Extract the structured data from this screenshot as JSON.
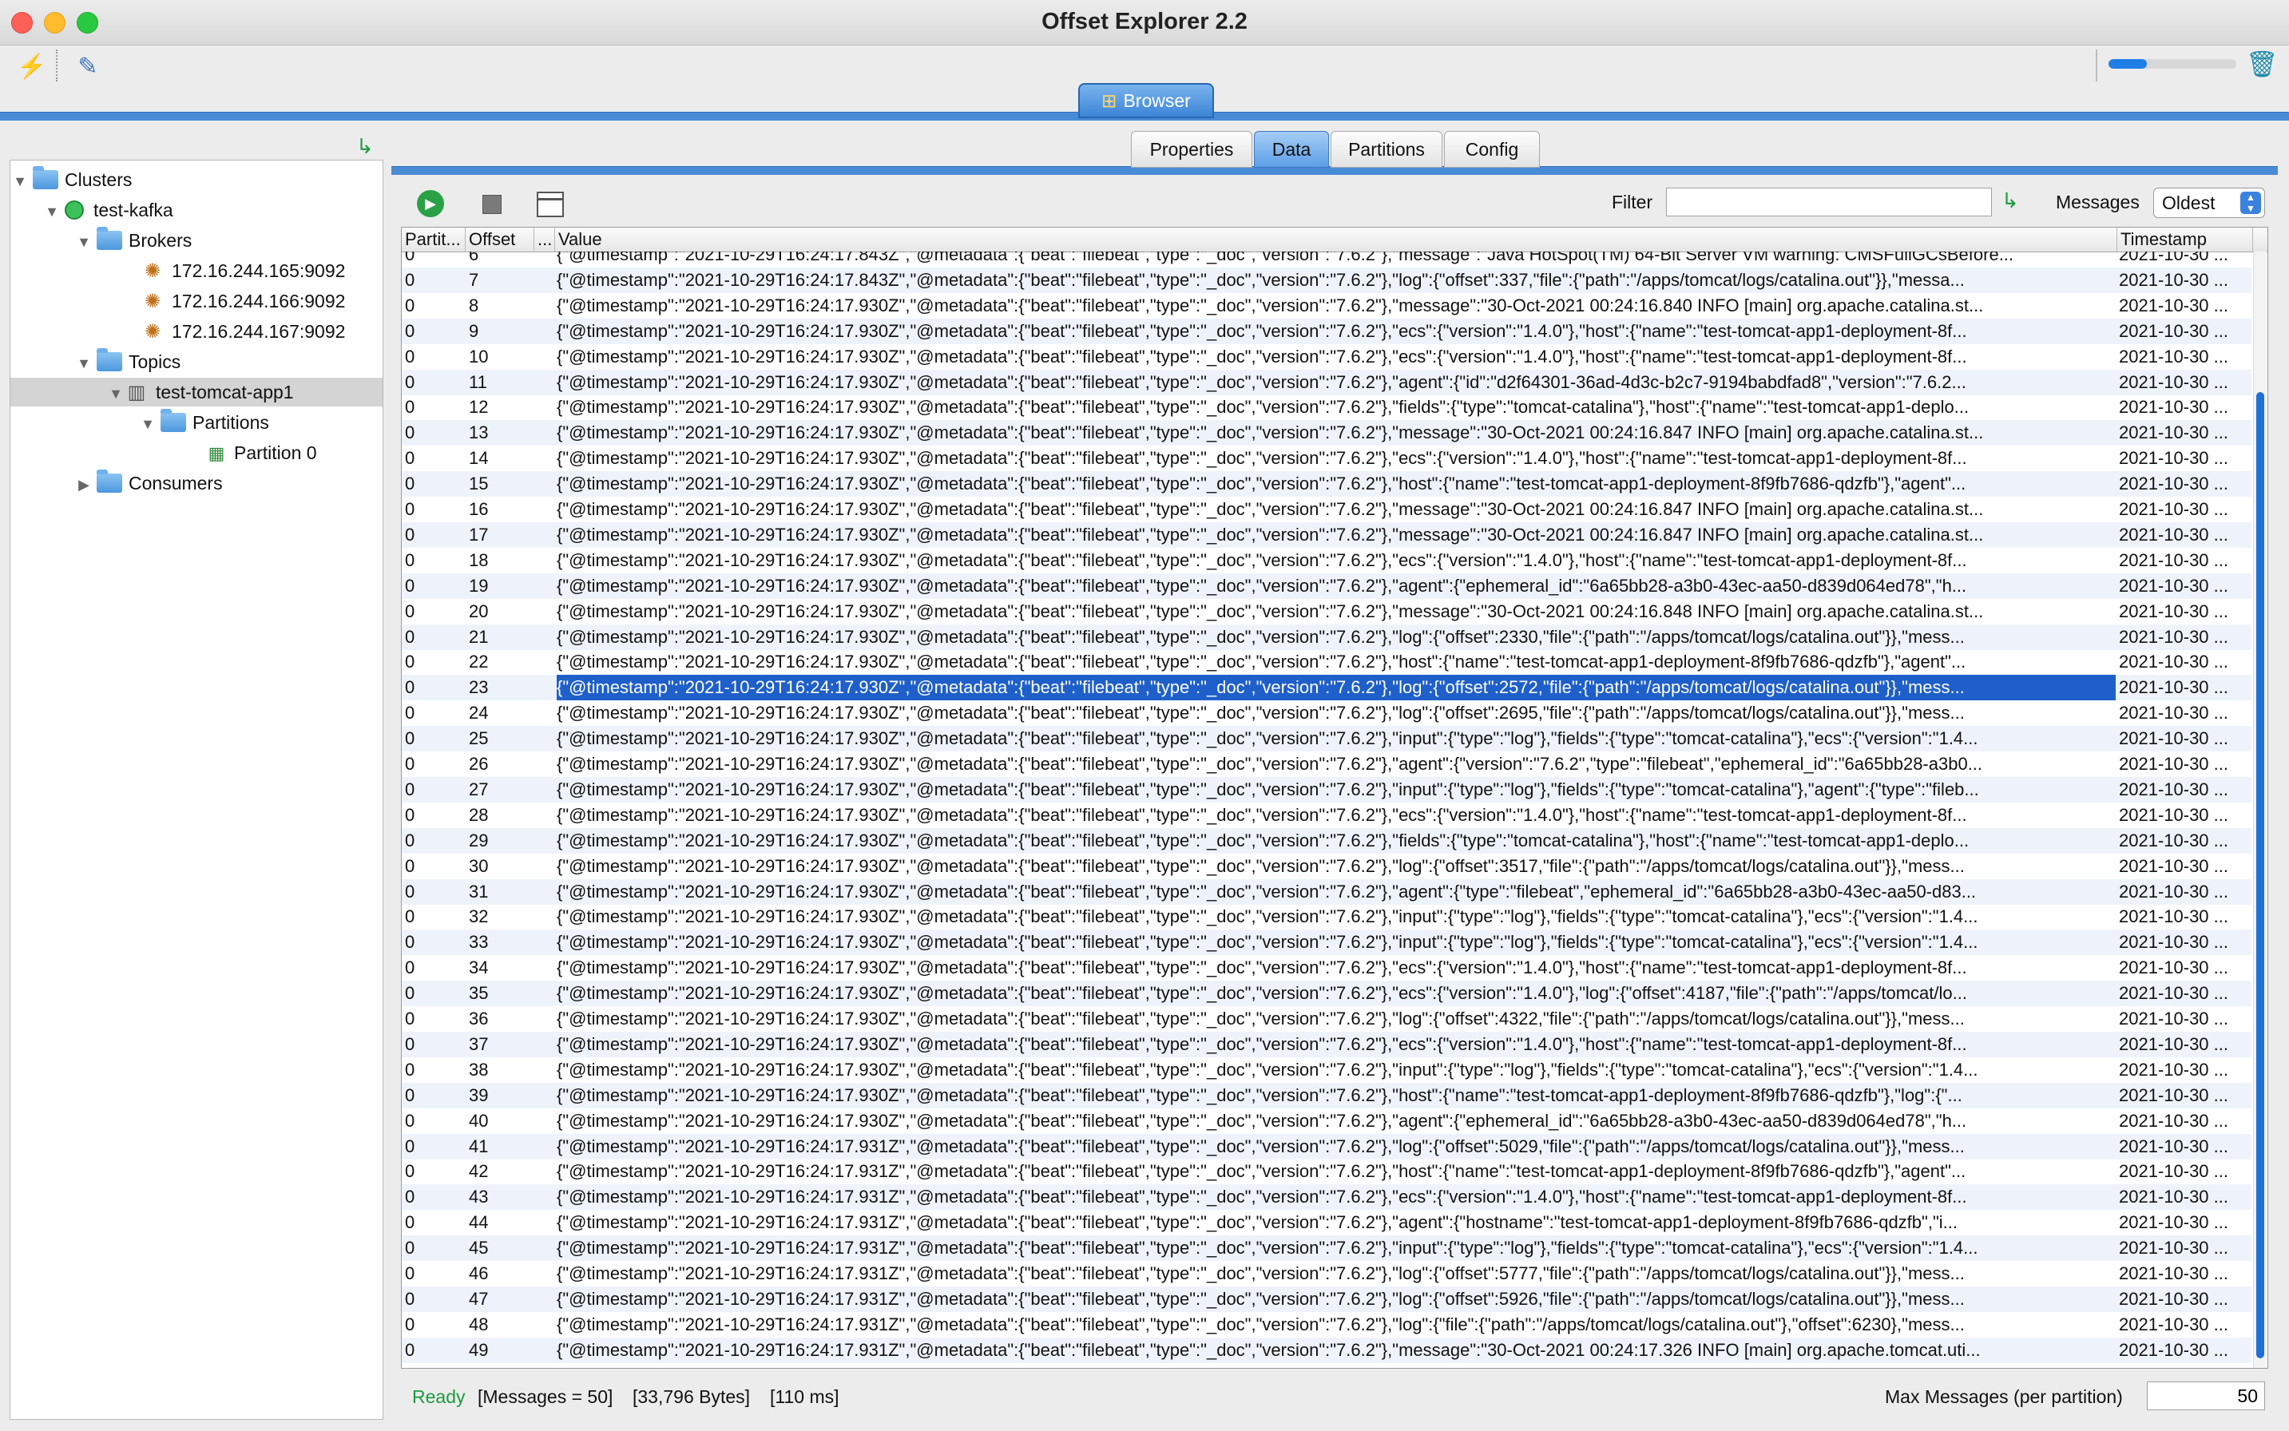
{
  "window": {
    "title": "Offset Explorer  2.2"
  },
  "toolbar": {
    "progress": 0.3
  },
  "main_tab": {
    "label": "Browser"
  },
  "tree": {
    "clusters_label": "Clusters",
    "cluster_name": "test-kafka",
    "brokers_label": "Brokers",
    "brokers": [
      "172.16.244.165:9092",
      "172.16.244.166:9092",
      "172.16.244.167:9092"
    ],
    "topics_label": "Topics",
    "topic_name": "test-tomcat-app1",
    "partitions_label": "Partitions",
    "partition_label": "Partition 0",
    "consumers_label": "Consumers"
  },
  "subtabs": [
    "Properties",
    "Data",
    "Partitions",
    "Config"
  ],
  "data_toolbar": {
    "filter_label": "Filter",
    "filter_value": "",
    "messages_label": "Messages",
    "messages_selected": "Oldest"
  },
  "table": {
    "columns": [
      "Partit...",
      "Offset",
      "...",
      "Value",
      "Timestamp"
    ],
    "rows": [
      [
        "0",
        "6",
        "",
        "{\"@timestamp\":\"2021-10-29T16:24:17.843Z\",\"@metadata\":{\"beat\":\"filebeat\",\"type\":\"_doc\",\"version\":\"7.6.2\"},\"message\":\"Java HotSpot(TM) 64-Bit Server VM warning: CMSFullGCsBefore...",
        "2021-10-30 ..."
      ],
      [
        "0",
        "7",
        "",
        "{\"@timestamp\":\"2021-10-29T16:24:17.843Z\",\"@metadata\":{\"beat\":\"filebeat\",\"type\":\"_doc\",\"version\":\"7.6.2\"},\"log\":{\"offset\":337,\"file\":{\"path\":\"/apps/tomcat/logs/catalina.out\"}},\"messa...",
        "2021-10-30 ..."
      ],
      [
        "0",
        "8",
        "",
        "{\"@timestamp\":\"2021-10-29T16:24:17.930Z\",\"@metadata\":{\"beat\":\"filebeat\",\"type\":\"_doc\",\"version\":\"7.6.2\"},\"message\":\"30-Oct-2021 00:24:16.840 INFO [main] org.apache.catalina.st...",
        "2021-10-30 ..."
      ],
      [
        "0",
        "9",
        "",
        "{\"@timestamp\":\"2021-10-29T16:24:17.930Z\",\"@metadata\":{\"beat\":\"filebeat\",\"type\":\"_doc\",\"version\":\"7.6.2\"},\"ecs\":{\"version\":\"1.4.0\"},\"host\":{\"name\":\"test-tomcat-app1-deployment-8f...",
        "2021-10-30 ..."
      ],
      [
        "0",
        "10",
        "",
        "{\"@timestamp\":\"2021-10-29T16:24:17.930Z\",\"@metadata\":{\"beat\":\"filebeat\",\"type\":\"_doc\",\"version\":\"7.6.2\"},\"ecs\":{\"version\":\"1.4.0\"},\"host\":{\"name\":\"test-tomcat-app1-deployment-8f...",
        "2021-10-30 ..."
      ],
      [
        "0",
        "11",
        "",
        "{\"@timestamp\":\"2021-10-29T16:24:17.930Z\",\"@metadata\":{\"beat\":\"filebeat\",\"type\":\"_doc\",\"version\":\"7.6.2\"},\"agent\":{\"id\":\"d2f64301-36ad-4d3c-b2c7-9194babdfad8\",\"version\":\"7.6.2...",
        "2021-10-30 ..."
      ],
      [
        "0",
        "12",
        "",
        "{\"@timestamp\":\"2021-10-29T16:24:17.930Z\",\"@metadata\":{\"beat\":\"filebeat\",\"type\":\"_doc\",\"version\":\"7.6.2\"},\"fields\":{\"type\":\"tomcat-catalina\"},\"host\":{\"name\":\"test-tomcat-app1-deplo...",
        "2021-10-30 ..."
      ],
      [
        "0",
        "13",
        "",
        "{\"@timestamp\":\"2021-10-29T16:24:17.930Z\",\"@metadata\":{\"beat\":\"filebeat\",\"type\":\"_doc\",\"version\":\"7.6.2\"},\"message\":\"30-Oct-2021 00:24:16.847 INFO [main] org.apache.catalina.st...",
        "2021-10-30 ..."
      ],
      [
        "0",
        "14",
        "",
        "{\"@timestamp\":\"2021-10-29T16:24:17.930Z\",\"@metadata\":{\"beat\":\"filebeat\",\"type\":\"_doc\",\"version\":\"7.6.2\"},\"ecs\":{\"version\":\"1.4.0\"},\"host\":{\"name\":\"test-tomcat-app1-deployment-8f...",
        "2021-10-30 ..."
      ],
      [
        "0",
        "15",
        "",
        "{\"@timestamp\":\"2021-10-29T16:24:17.930Z\",\"@metadata\":{\"beat\":\"filebeat\",\"type\":\"_doc\",\"version\":\"7.6.2\"},\"host\":{\"name\":\"test-tomcat-app1-deployment-8f9fb7686-qdzfb\"},\"agent\"...",
        "2021-10-30 ..."
      ],
      [
        "0",
        "16",
        "",
        "{\"@timestamp\":\"2021-10-29T16:24:17.930Z\",\"@metadata\":{\"beat\":\"filebeat\",\"type\":\"_doc\",\"version\":\"7.6.2\"},\"message\":\"30-Oct-2021 00:24:16.847 INFO [main] org.apache.catalina.st...",
        "2021-10-30 ..."
      ],
      [
        "0",
        "17",
        "",
        "{\"@timestamp\":\"2021-10-29T16:24:17.930Z\",\"@metadata\":{\"beat\":\"filebeat\",\"type\":\"_doc\",\"version\":\"7.6.2\"},\"message\":\"30-Oct-2021 00:24:16.847 INFO [main] org.apache.catalina.st...",
        "2021-10-30 ..."
      ],
      [
        "0",
        "18",
        "",
        "{\"@timestamp\":\"2021-10-29T16:24:17.930Z\",\"@metadata\":{\"beat\":\"filebeat\",\"type\":\"_doc\",\"version\":\"7.6.2\"},\"ecs\":{\"version\":\"1.4.0\"},\"host\":{\"name\":\"test-tomcat-app1-deployment-8f...",
        "2021-10-30 ..."
      ],
      [
        "0",
        "19",
        "",
        "{\"@timestamp\":\"2021-10-29T16:24:17.930Z\",\"@metadata\":{\"beat\":\"filebeat\",\"type\":\"_doc\",\"version\":\"7.6.2\"},\"agent\":{\"ephemeral_id\":\"6a65bb28-a3b0-43ec-aa50-d839d064ed78\",\"h...",
        "2021-10-30 ..."
      ],
      [
        "0",
        "20",
        "",
        "{\"@timestamp\":\"2021-10-29T16:24:17.930Z\",\"@metadata\":{\"beat\":\"filebeat\",\"type\":\"_doc\",\"version\":\"7.6.2\"},\"message\":\"30-Oct-2021 00:24:16.848 INFO [main] org.apache.catalina.st...",
        "2021-10-30 ..."
      ],
      [
        "0",
        "21",
        "",
        "{\"@timestamp\":\"2021-10-29T16:24:17.930Z\",\"@metadata\":{\"beat\":\"filebeat\",\"type\":\"_doc\",\"version\":\"7.6.2\"},\"log\":{\"offset\":2330,\"file\":{\"path\":\"/apps/tomcat/logs/catalina.out\"}},\"mess...",
        "2021-10-30 ..."
      ],
      [
        "0",
        "22",
        "",
        "{\"@timestamp\":\"2021-10-29T16:24:17.930Z\",\"@metadata\":{\"beat\":\"filebeat\",\"type\":\"_doc\",\"version\":\"7.6.2\"},\"host\":{\"name\":\"test-tomcat-app1-deployment-8f9fb7686-qdzfb\"},\"agent\"...",
        "2021-10-30 ..."
      ],
      [
        "0",
        "23",
        "",
        "{\"@timestamp\":\"2021-10-29T16:24:17.930Z\",\"@metadata\":{\"beat\":\"filebeat\",\"type\":\"_doc\",\"version\":\"7.6.2\"},\"log\":{\"offset\":2572,\"file\":{\"path\":\"/apps/tomcat/logs/catalina.out\"}},\"mess...",
        "2021-10-30 ..."
      ],
      [
        "0",
        "24",
        "",
        "{\"@timestamp\":\"2021-10-29T16:24:17.930Z\",\"@metadata\":{\"beat\":\"filebeat\",\"type\":\"_doc\",\"version\":\"7.6.2\"},\"log\":{\"offset\":2695,\"file\":{\"path\":\"/apps/tomcat/logs/catalina.out\"}},\"mess...",
        "2021-10-30 ..."
      ],
      [
        "0",
        "25",
        "",
        "{\"@timestamp\":\"2021-10-29T16:24:17.930Z\",\"@metadata\":{\"beat\":\"filebeat\",\"type\":\"_doc\",\"version\":\"7.6.2\"},\"input\":{\"type\":\"log\"},\"fields\":{\"type\":\"tomcat-catalina\"},\"ecs\":{\"version\":\"1.4...",
        "2021-10-30 ..."
      ],
      [
        "0",
        "26",
        "",
        "{\"@timestamp\":\"2021-10-29T16:24:17.930Z\",\"@metadata\":{\"beat\":\"filebeat\",\"type\":\"_doc\",\"version\":\"7.6.2\"},\"agent\":{\"version\":\"7.6.2\",\"type\":\"filebeat\",\"ephemeral_id\":\"6a65bb28-a3b0...",
        "2021-10-30 ..."
      ],
      [
        "0",
        "27",
        "",
        "{\"@timestamp\":\"2021-10-29T16:24:17.930Z\",\"@metadata\":{\"beat\":\"filebeat\",\"type\":\"_doc\",\"version\":\"7.6.2\"},\"input\":{\"type\":\"log\"},\"fields\":{\"type\":\"tomcat-catalina\"},\"agent\":{\"type\":\"fileb...",
        "2021-10-30 ..."
      ],
      [
        "0",
        "28",
        "",
        "{\"@timestamp\":\"2021-10-29T16:24:17.930Z\",\"@metadata\":{\"beat\":\"filebeat\",\"type\":\"_doc\",\"version\":\"7.6.2\"},\"ecs\":{\"version\":\"1.4.0\"},\"host\":{\"name\":\"test-tomcat-app1-deployment-8f...",
        "2021-10-30 ..."
      ],
      [
        "0",
        "29",
        "",
        "{\"@timestamp\":\"2021-10-29T16:24:17.930Z\",\"@metadata\":{\"beat\":\"filebeat\",\"type\":\"_doc\",\"version\":\"7.6.2\"},\"fields\":{\"type\":\"tomcat-catalina\"},\"host\":{\"name\":\"test-tomcat-app1-deplo...",
        "2021-10-30 ..."
      ],
      [
        "0",
        "30",
        "",
        "{\"@timestamp\":\"2021-10-29T16:24:17.930Z\",\"@metadata\":{\"beat\":\"filebeat\",\"type\":\"_doc\",\"version\":\"7.6.2\"},\"log\":{\"offset\":3517,\"file\":{\"path\":\"/apps/tomcat/logs/catalina.out\"}},\"mess...",
        "2021-10-30 ..."
      ],
      [
        "0",
        "31",
        "",
        "{\"@timestamp\":\"2021-10-29T16:24:17.930Z\",\"@metadata\":{\"beat\":\"filebeat\",\"type\":\"_doc\",\"version\":\"7.6.2\"},\"agent\":{\"type\":\"filebeat\",\"ephemeral_id\":\"6a65bb28-a3b0-43ec-aa50-d83...",
        "2021-10-30 ..."
      ],
      [
        "0",
        "32",
        "",
        "{\"@timestamp\":\"2021-10-29T16:24:17.930Z\",\"@metadata\":{\"beat\":\"filebeat\",\"type\":\"_doc\",\"version\":\"7.6.2\"},\"input\":{\"type\":\"log\"},\"fields\":{\"type\":\"tomcat-catalina\"},\"ecs\":{\"version\":\"1.4...",
        "2021-10-30 ..."
      ],
      [
        "0",
        "33",
        "",
        "{\"@timestamp\":\"2021-10-29T16:24:17.930Z\",\"@metadata\":{\"beat\":\"filebeat\",\"type\":\"_doc\",\"version\":\"7.6.2\"},\"input\":{\"type\":\"log\"},\"fields\":{\"type\":\"tomcat-catalina\"},\"ecs\":{\"version\":\"1.4...",
        "2021-10-30 ..."
      ],
      [
        "0",
        "34",
        "",
        "{\"@timestamp\":\"2021-10-29T16:24:17.930Z\",\"@metadata\":{\"beat\":\"filebeat\",\"type\":\"_doc\",\"version\":\"7.6.2\"},\"ecs\":{\"version\":\"1.4.0\"},\"host\":{\"name\":\"test-tomcat-app1-deployment-8f...",
        "2021-10-30 ..."
      ],
      [
        "0",
        "35",
        "",
        "{\"@timestamp\":\"2021-10-29T16:24:17.930Z\",\"@metadata\":{\"beat\":\"filebeat\",\"type\":\"_doc\",\"version\":\"7.6.2\"},\"ecs\":{\"version\":\"1.4.0\"},\"log\":{\"offset\":4187,\"file\":{\"path\":\"/apps/tomcat/lo...",
        "2021-10-30 ..."
      ],
      [
        "0",
        "36",
        "",
        "{\"@timestamp\":\"2021-10-29T16:24:17.930Z\",\"@metadata\":{\"beat\":\"filebeat\",\"type\":\"_doc\",\"version\":\"7.6.2\"},\"log\":{\"offset\":4322,\"file\":{\"path\":\"/apps/tomcat/logs/catalina.out\"}},\"mess...",
        "2021-10-30 ..."
      ],
      [
        "0",
        "37",
        "",
        "{\"@timestamp\":\"2021-10-29T16:24:17.930Z\",\"@metadata\":{\"beat\":\"filebeat\",\"type\":\"_doc\",\"version\":\"7.6.2\"},\"ecs\":{\"version\":\"1.4.0\"},\"host\":{\"name\":\"test-tomcat-app1-deployment-8f...",
        "2021-10-30 ..."
      ],
      [
        "0",
        "38",
        "",
        "{\"@timestamp\":\"2021-10-29T16:24:17.930Z\",\"@metadata\":{\"beat\":\"filebeat\",\"type\":\"_doc\",\"version\":\"7.6.2\"},\"input\":{\"type\":\"log\"},\"fields\":{\"type\":\"tomcat-catalina\"},\"ecs\":{\"version\":\"1.4...",
        "2021-10-30 ..."
      ],
      [
        "0",
        "39",
        "",
        "{\"@timestamp\":\"2021-10-29T16:24:17.930Z\",\"@metadata\":{\"beat\":\"filebeat\",\"type\":\"_doc\",\"version\":\"7.6.2\"},\"host\":{\"name\":\"test-tomcat-app1-deployment-8f9fb7686-qdzfb\"},\"log\":{\"...",
        "2021-10-30 ..."
      ],
      [
        "0",
        "40",
        "",
        "{\"@timestamp\":\"2021-10-29T16:24:17.930Z\",\"@metadata\":{\"beat\":\"filebeat\",\"type\":\"_doc\",\"version\":\"7.6.2\"},\"agent\":{\"ephemeral_id\":\"6a65bb28-a3b0-43ec-aa50-d839d064ed78\",\"h...",
        "2021-10-30 ..."
      ],
      [
        "0",
        "41",
        "",
        "{\"@timestamp\":\"2021-10-29T16:24:17.931Z\",\"@metadata\":{\"beat\":\"filebeat\",\"type\":\"_doc\",\"version\":\"7.6.2\"},\"log\":{\"offset\":5029,\"file\":{\"path\":\"/apps/tomcat/logs/catalina.out\"}},\"mess...",
        "2021-10-30 ..."
      ],
      [
        "0",
        "42",
        "",
        "{\"@timestamp\":\"2021-10-29T16:24:17.931Z\",\"@metadata\":{\"beat\":\"filebeat\",\"type\":\"_doc\",\"version\":\"7.6.2\"},\"host\":{\"name\":\"test-tomcat-app1-deployment-8f9fb7686-qdzfb\"},\"agent\"...",
        "2021-10-30 ..."
      ],
      [
        "0",
        "43",
        "",
        "{\"@timestamp\":\"2021-10-29T16:24:17.931Z\",\"@metadata\":{\"beat\":\"filebeat\",\"type\":\"_doc\",\"version\":\"7.6.2\"},\"ecs\":{\"version\":\"1.4.0\"},\"host\":{\"name\":\"test-tomcat-app1-deployment-8f...",
        "2021-10-30 ..."
      ],
      [
        "0",
        "44",
        "",
        "{\"@timestamp\":\"2021-10-29T16:24:17.931Z\",\"@metadata\":{\"beat\":\"filebeat\",\"type\":\"_doc\",\"version\":\"7.6.2\"},\"agent\":{\"hostname\":\"test-tomcat-app1-deployment-8f9fb7686-qdzfb\",\"i...",
        "2021-10-30 ..."
      ],
      [
        "0",
        "45",
        "",
        "{\"@timestamp\":\"2021-10-29T16:24:17.931Z\",\"@metadata\":{\"beat\":\"filebeat\",\"type\":\"_doc\",\"version\":\"7.6.2\"},\"input\":{\"type\":\"log\"},\"fields\":{\"type\":\"tomcat-catalina\"},\"ecs\":{\"version\":\"1.4...",
        "2021-10-30 ..."
      ],
      [
        "0",
        "46",
        "",
        "{\"@timestamp\":\"2021-10-29T16:24:17.931Z\",\"@metadata\":{\"beat\":\"filebeat\",\"type\":\"_doc\",\"version\":\"7.6.2\"},\"log\":{\"offset\":5777,\"file\":{\"path\":\"/apps/tomcat/logs/catalina.out\"}},\"mess...",
        "2021-10-30 ..."
      ],
      [
        "0",
        "47",
        "",
        "{\"@timestamp\":\"2021-10-29T16:24:17.931Z\",\"@metadata\":{\"beat\":\"filebeat\",\"type\":\"_doc\",\"version\":\"7.6.2\"},\"log\":{\"offset\":5926,\"file\":{\"path\":\"/apps/tomcat/logs/catalina.out\"}},\"mess...",
        "2021-10-30 ..."
      ],
      [
        "0",
        "48",
        "",
        "{\"@timestamp\":\"2021-10-29T16:24:17.931Z\",\"@metadata\":{\"beat\":\"filebeat\",\"type\":\"_doc\",\"version\":\"7.6.2\"},\"log\":{\"file\":{\"path\":\"/apps/tomcat/logs/catalina.out\"},\"offset\":6230},\"mess...",
        "2021-10-30 ..."
      ],
      [
        "0",
        "49",
        "",
        "{\"@timestamp\":\"2021-10-29T16:24:17.931Z\",\"@metadata\":{\"beat\":\"filebeat\",\"type\":\"_doc\",\"version\":\"7.6.2\"},\"message\":\"30-Oct-2021 00:24:17.326 INFO [main] org.apache.tomcat.uti...",
        "2021-10-30 ..."
      ]
    ],
    "selected_offset": "23"
  },
  "statusbar": {
    "status": "Ready",
    "messages": "[Messages = 50]",
    "bytes": "[33,796 Bytes]",
    "time": "[110 ms]",
    "max_label": "Max Messages (per partition)",
    "max_value": "50"
  },
  "colors": {
    "accent": "#4a8bd6",
    "selection": "#1f5fca",
    "ready": "#1c9b3f"
  }
}
